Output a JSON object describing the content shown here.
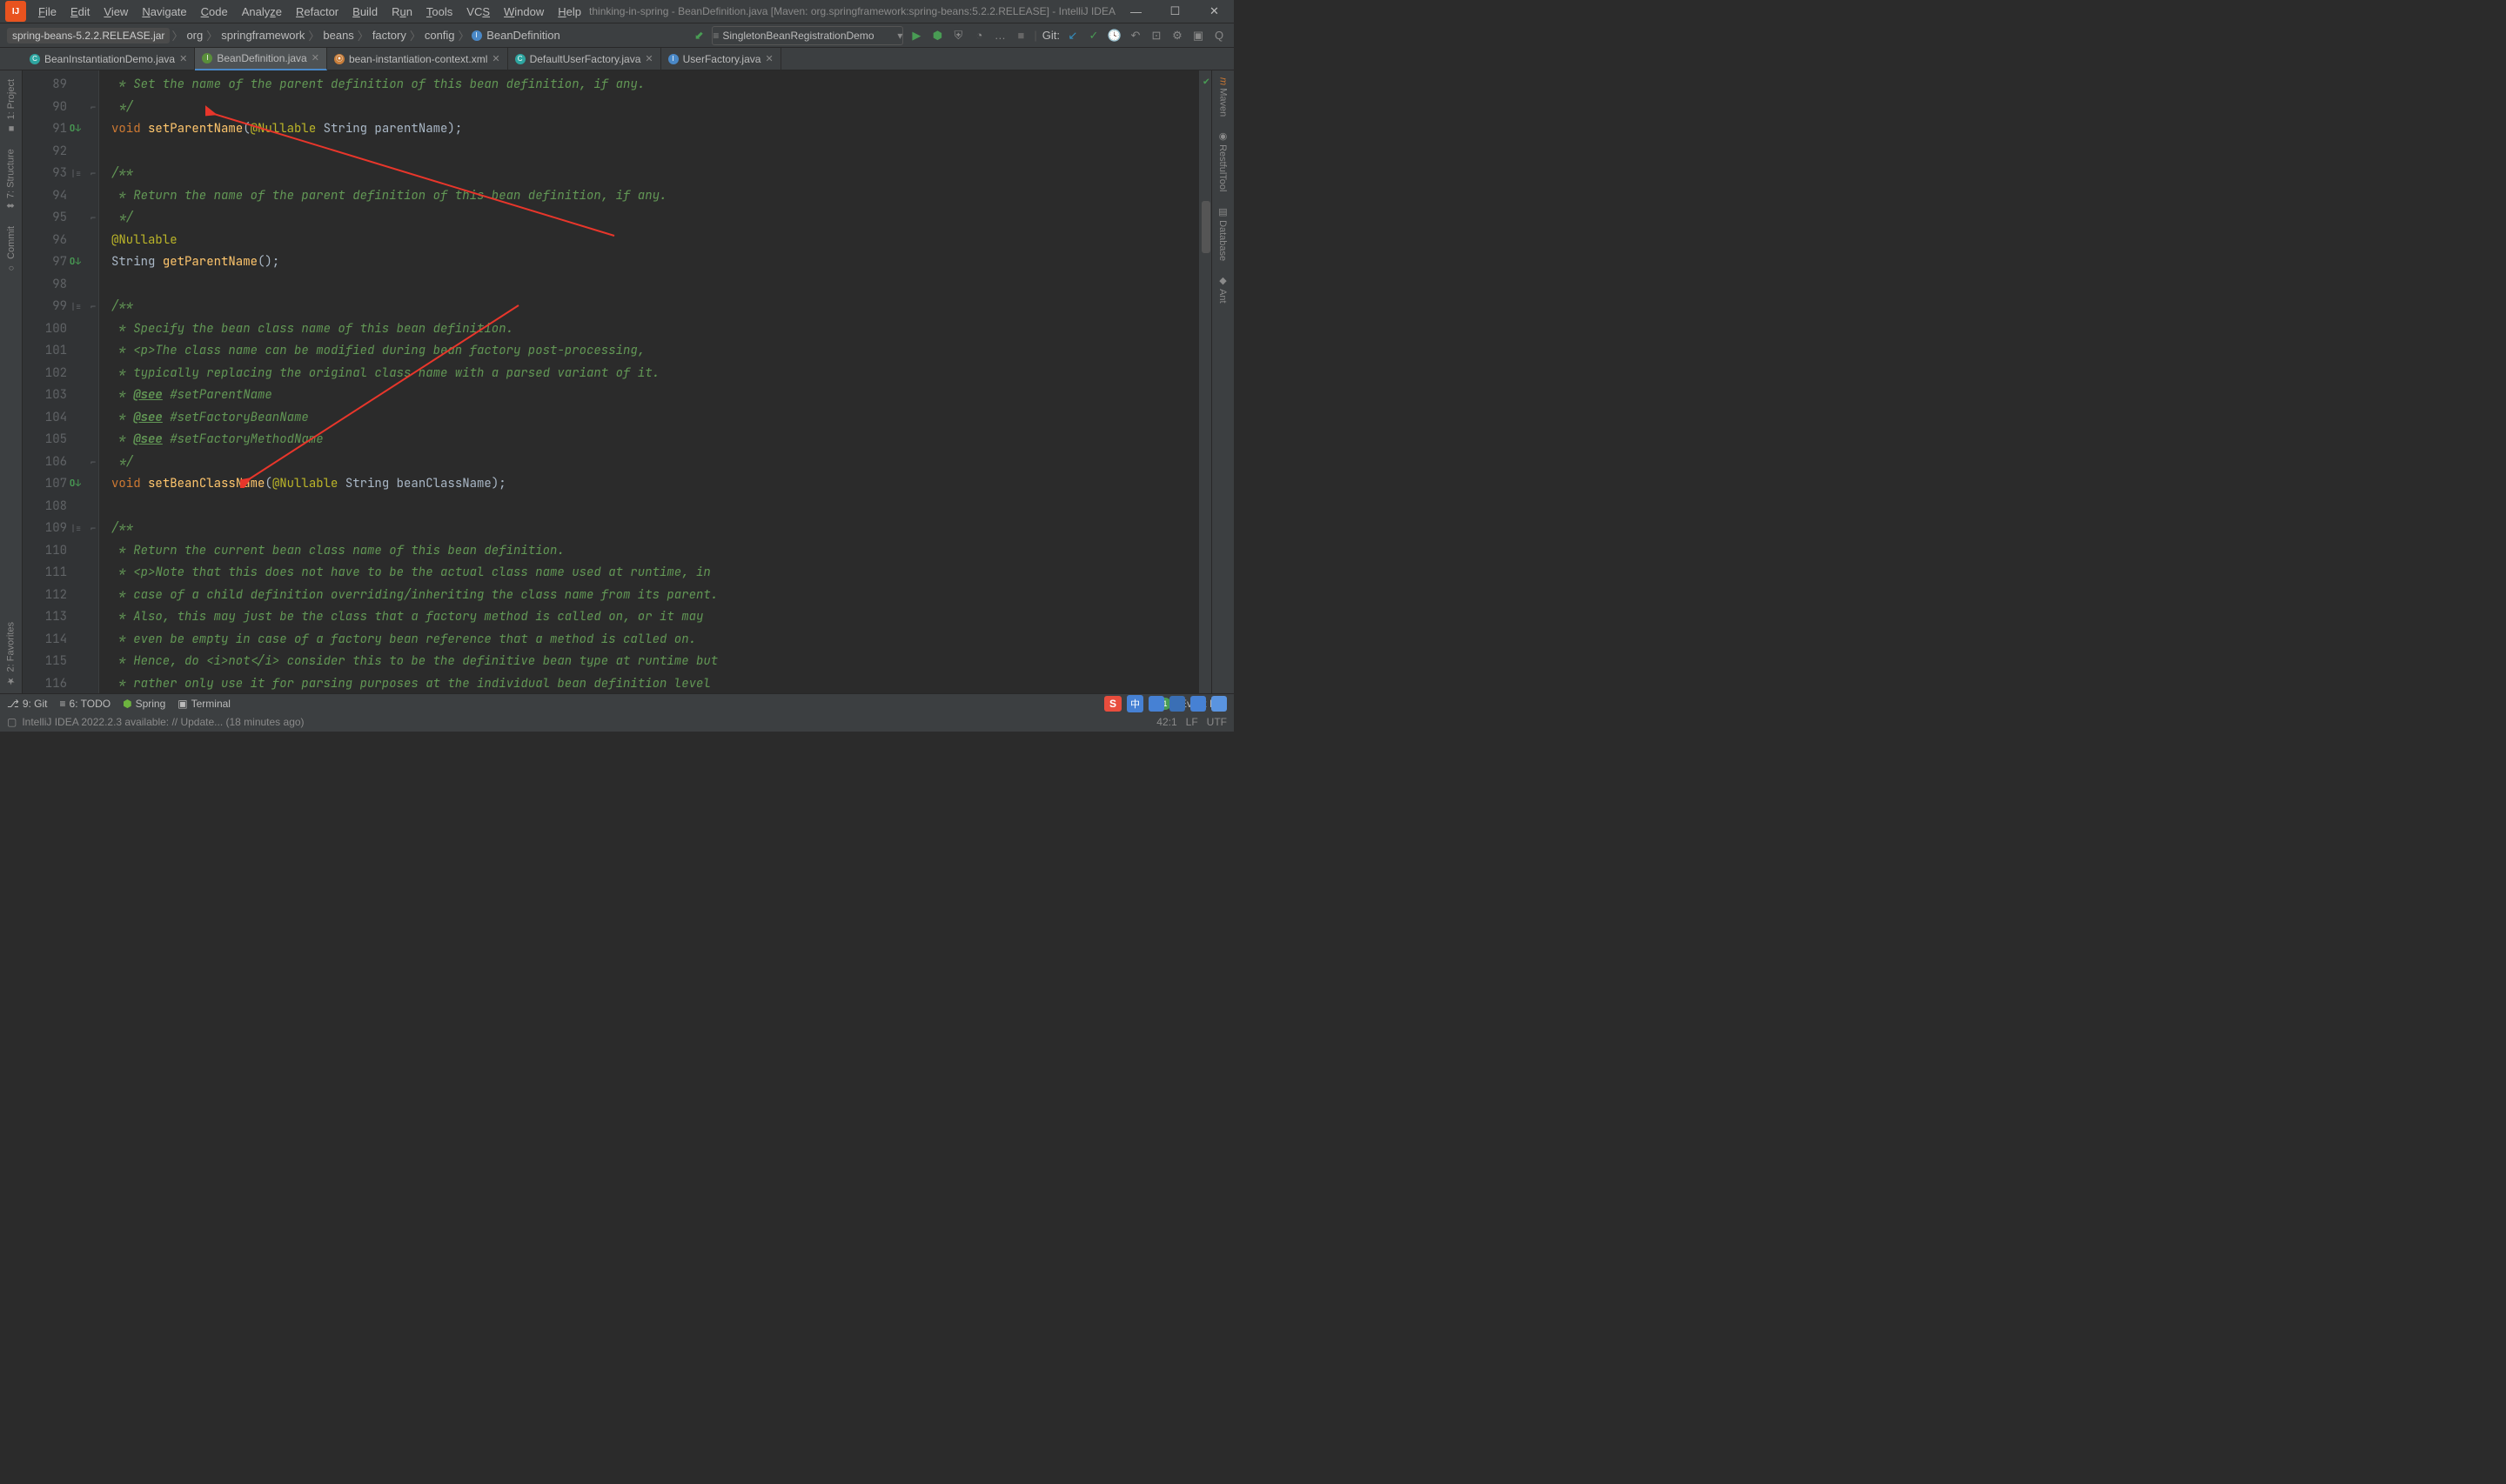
{
  "title": "thinking-in-spring - BeanDefinition.java [Maven: org.springframework:spring-beans:5.2.2.RELEASE] - IntelliJ IDEA",
  "menu": [
    "File",
    "Edit",
    "View",
    "Navigate",
    "Code",
    "Analyze",
    "Refactor",
    "Build",
    "Run",
    "Tools",
    "VCS",
    "Window",
    "Help"
  ],
  "breadcrumb": {
    "jar": "spring-beans-5.2.2.RELEASE.jar",
    "parts": [
      "org",
      "springframework",
      "beans",
      "factory",
      "config",
      "BeanDefinition"
    ]
  },
  "run_config": "SingletonBeanRegistrationDemo",
  "git_label": "Git:",
  "tabs": [
    {
      "label": "BeanInstantiationDemo.java",
      "icon": "c-cy"
    },
    {
      "label": "BeanDefinition.java",
      "icon": "c-gr",
      "active": true
    },
    {
      "label": "bean-instantiation-context.xml",
      "icon": "c-or"
    },
    {
      "label": "DefaultUserFactory.java",
      "icon": "c-cy"
    },
    {
      "label": "UserFactory.java",
      "icon": "c-bl"
    }
  ],
  "left_tools": [
    "1: Project",
    "7: Structure",
    "Commit",
    "2: Favorites"
  ],
  "right_tools": [
    "Maven",
    "RestfulTool",
    "Database",
    "Ant"
  ],
  "lines": [
    89,
    90,
    91,
    92,
    93,
    94,
    95,
    96,
    97,
    98,
    99,
    100,
    101,
    102,
    103,
    104,
    105,
    106,
    107,
    108,
    109,
    110,
    111,
    112,
    113,
    114,
    115,
    116
  ],
  "code": {
    "l89": " * Set the name of the parent definition of this bean definition, if any.",
    "l90": " */",
    "l93": "/**",
    "l94": " * Return the name of the parent definition of this bean definition, if any.",
    "l95": " */",
    "l99": "/**",
    "l100": " * Specify the bean class name of this bean definition.",
    "l101a": " * <p>",
    "l101b": "The class name can be modified during bean factory post-processing,",
    "l102": " * typically replacing the original class name with a parsed variant of it.",
    "l103a": " * ",
    "l103b": "@see",
    "l103c": " #setParentName",
    "l104a": " * ",
    "l104b": "@see",
    "l104c": " #setFactoryBeanName",
    "l105a": " * ",
    "l105b": "@see",
    "l105c": " #setFactoryMethodName",
    "l106": " */",
    "l109": "/**",
    "l110": " * Return the current bean class name of this bean definition.",
    "l111a": " * <p>",
    "l111b": "Note that this does not have to be the actual class name used at runtime, in",
    "l112": " * case of a child definition overriding/inheriting the class name from its parent.",
    "l113": " * Also, this may just be the class that a factory method is called on, or it may",
    "l114": " * even be empty in case of a factory bean reference that a method is called on.",
    "l115": " * Hence, do <i>not</i> consider this to be the definitive bean type at runtime but",
    "l116": " * rather only use it for parsing purposes at the individual bean definition level",
    "void": "void",
    "str": "String",
    "nul": "@Nullable",
    "fn91": "setParentName",
    "p91": " String parentName);",
    "fn97": "getParentName",
    "p97": "();",
    "fn107": "setBeanClassName",
    "p107": " String beanClassName);"
  },
  "status": {
    "git": "9: Git",
    "todo": "6: TODO",
    "spring": "Spring",
    "terminal": "Terminal",
    "eventlog": "Event Log",
    "update": "IntelliJ IDEA 2022.2.3 available: // Update... (18 minutes ago)",
    "pos": "42:1",
    "lf": "LF",
    "enc": "UTF"
  },
  "overlay_letter": "S",
  "overlay_cn": "中"
}
